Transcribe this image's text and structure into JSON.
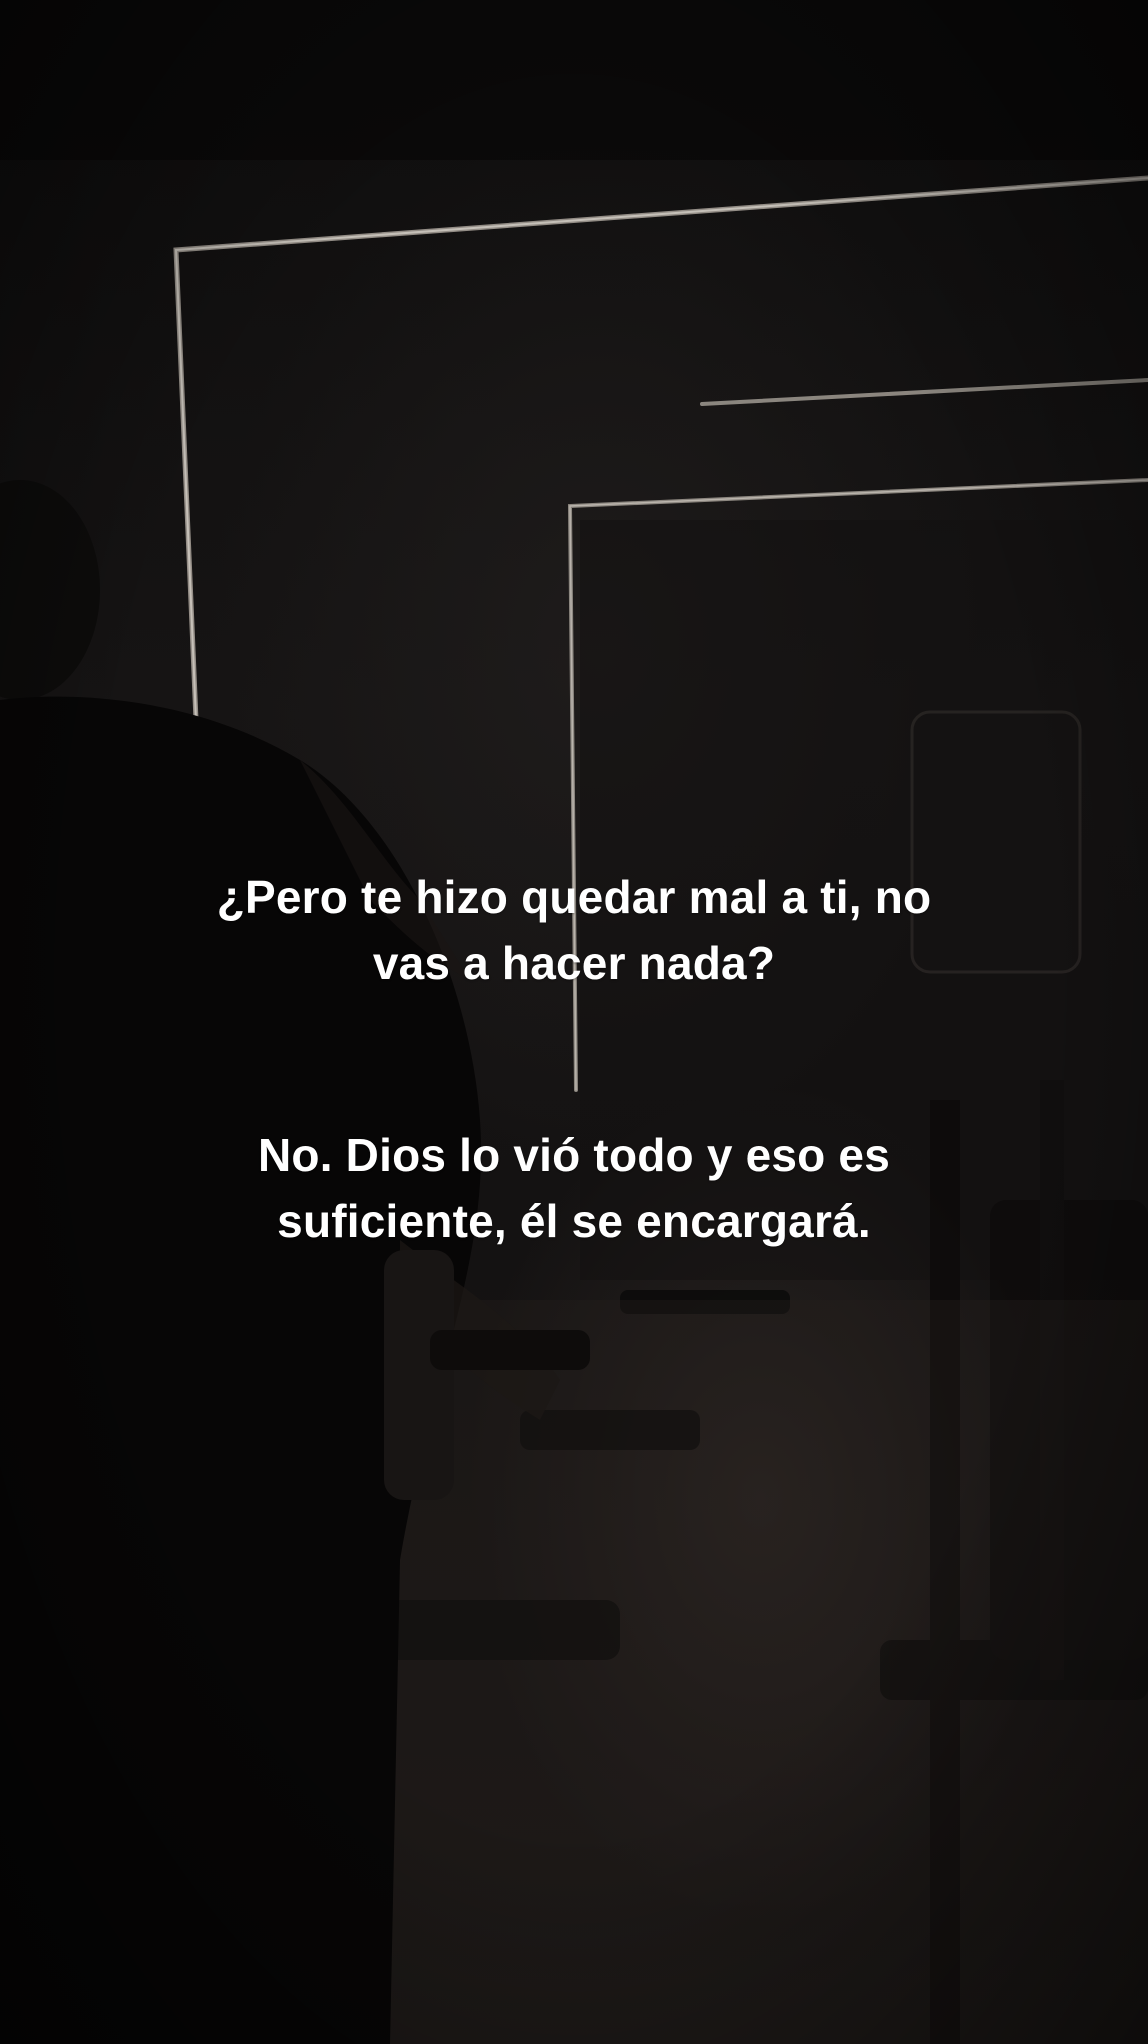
{
  "story": {
    "question_lines": [
      "¿Pero te hizo quedar mal a ti, no",
      "vas a hacer nada?"
    ],
    "answer_lines": [
      "No. Dios lo vió todo y eso es",
      "suficiente, él se encargará."
    ]
  },
  "colors": {
    "background": "#0a0909",
    "text": "#ffffff",
    "led_light": "#bdb6ae"
  }
}
